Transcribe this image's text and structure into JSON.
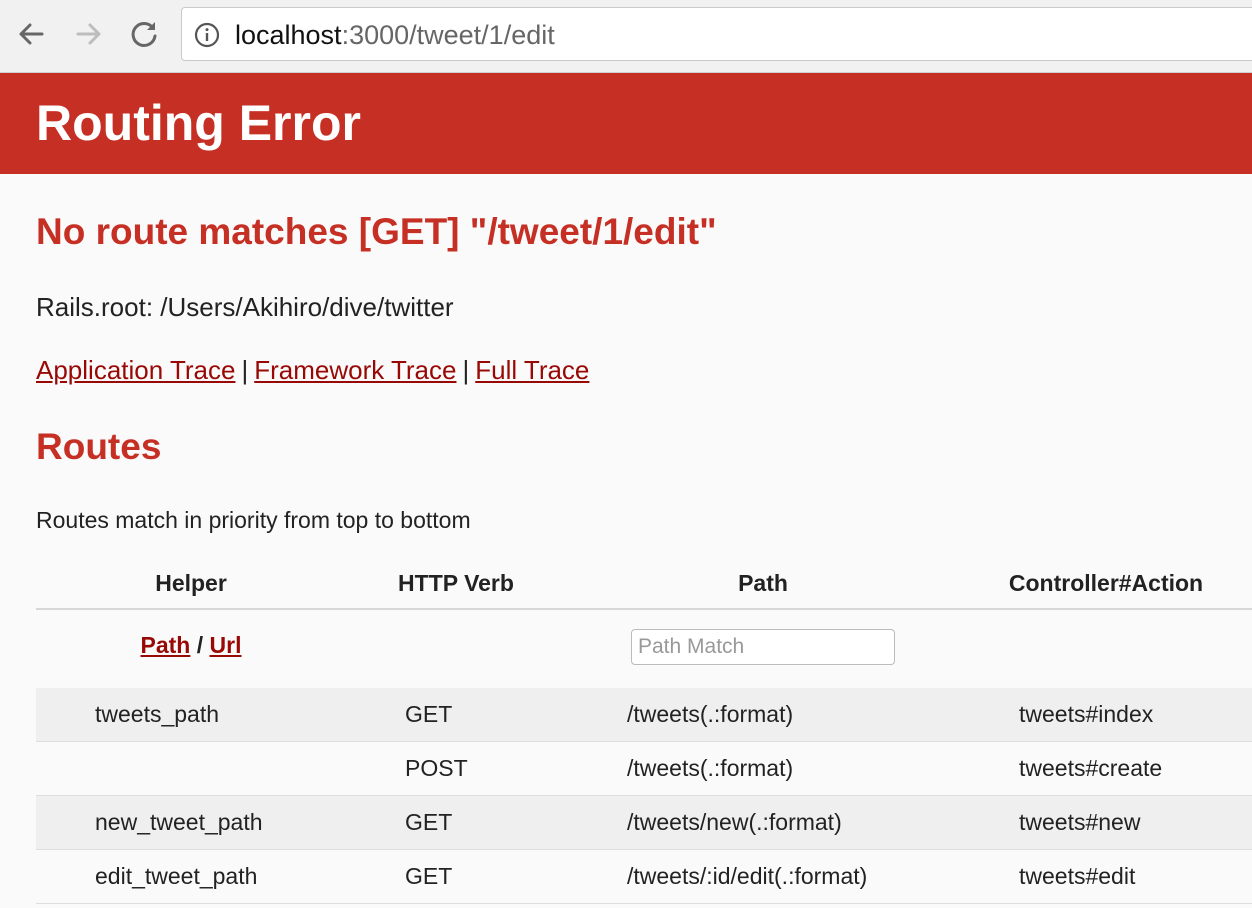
{
  "browser": {
    "url_host": "localhost",
    "url_rest": ":3000/tweet/1/edit",
    "icons": [
      "back-arrow-icon",
      "forward-arrow-icon",
      "reload-icon",
      "info-icon"
    ]
  },
  "page": {
    "title": "Routing Error",
    "route_message": "No route matches [GET] \"/tweet/1/edit\"",
    "rails_root": "Rails.root: /Users/Akihiro/dive/twitter",
    "trace_links": [
      "Application Trace",
      "Framework Trace",
      "Full Trace"
    ],
    "trace_separator": "|",
    "routes_heading": "Routes",
    "priority_note": "Routes match in priority from top to bottom"
  },
  "routes_table": {
    "headers": [
      "Helper",
      "HTTP Verb",
      "Path",
      "Controller#Action"
    ],
    "path_link": "Path",
    "url_link": "Url",
    "path_url_separator": "/",
    "path_match_placeholder": "Path Match",
    "rows": [
      {
        "helper": "tweets_path",
        "verb": "GET",
        "path": "/tweets(.:format)",
        "action": "tweets#index"
      },
      {
        "helper": "",
        "verb": "POST",
        "path": "/tweets(.:format)",
        "action": "tweets#create"
      },
      {
        "helper": "new_tweet_path",
        "verb": "GET",
        "path": "/tweets/new(.:format)",
        "action": "tweets#new"
      },
      {
        "helper": "edit_tweet_path",
        "verb": "GET",
        "path": "/tweets/:id/edit(.:format)",
        "action": "tweets#edit"
      }
    ]
  },
  "colors": {
    "error_red": "#c52f24",
    "link_red": "#980905"
  }
}
